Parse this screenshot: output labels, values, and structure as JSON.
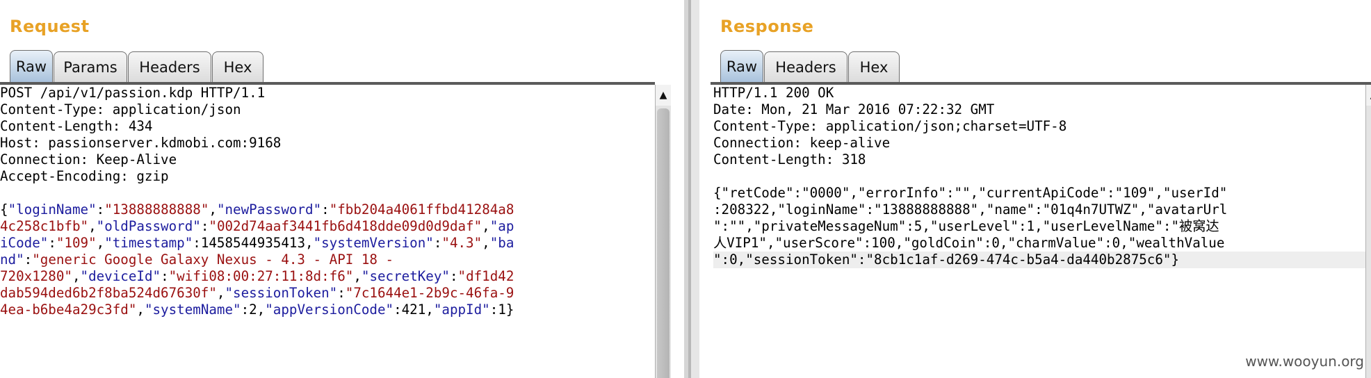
{
  "request": {
    "title": "Request",
    "tabs": [
      {
        "label": "Raw",
        "active": true
      },
      {
        "label": "Params",
        "active": false
      },
      {
        "label": "Headers",
        "active": false
      },
      {
        "label": "Hex",
        "active": false
      }
    ],
    "lines": [
      [
        {
          "t": "POST /api/v1/passion.kdp HTTP/1.1"
        }
      ],
      [
        {
          "t": "Content-Type: application/json"
        }
      ],
      [
        {
          "t": "Content-Length: 434"
        }
      ],
      [
        {
          "t": "Host: passionserver.kdmobi.com:9168"
        }
      ],
      [
        {
          "t": "Connection: Keep-Alive"
        }
      ],
      [
        {
          "t": "Accept-Encoding: gzip"
        }
      ],
      [
        {
          "t": ""
        }
      ],
      [
        {
          "t": "{"
        },
        {
          "t": "\"loginName\"",
          "c": "k"
        },
        {
          "t": ":"
        },
        {
          "t": "\"13888888888\"",
          "c": "s"
        },
        {
          "t": ","
        },
        {
          "t": "\"newPassword\"",
          "c": "k"
        },
        {
          "t": ":"
        },
        {
          "t": "\"fbb204a4061ffbd41284a8",
          "c": "s"
        }
      ],
      [
        {
          "t": "4c258c1bfb\"",
          "c": "s"
        },
        {
          "t": ","
        },
        {
          "t": "\"oldPassword\"",
          "c": "k"
        },
        {
          "t": ":"
        },
        {
          "t": "\"002d74aaf3441fb6d418dde09d0d9daf\"",
          "c": "s"
        },
        {
          "t": ","
        },
        {
          "t": "\"ap",
          "c": "k"
        }
      ],
      [
        {
          "t": "iCode\"",
          "c": "k"
        },
        {
          "t": ":"
        },
        {
          "t": "\"109\"",
          "c": "s"
        },
        {
          "t": ","
        },
        {
          "t": "\"timestamp\"",
          "c": "k"
        },
        {
          "t": ":1458544935413,"
        },
        {
          "t": "\"systemVersion\"",
          "c": "k"
        },
        {
          "t": ":"
        },
        {
          "t": "\"4.3\"",
          "c": "s"
        },
        {
          "t": ","
        },
        {
          "t": "\"ba",
          "c": "k"
        }
      ],
      [
        {
          "t": "nd\"",
          "c": "k"
        },
        {
          "t": ":"
        },
        {
          "t": "\"generic Google Galaxy Nexus - 4.3 - API 18 -",
          "c": "s"
        }
      ],
      [
        {
          "t": "720x1280\"",
          "c": "s"
        },
        {
          "t": ","
        },
        {
          "t": "\"deviceId\"",
          "c": "k"
        },
        {
          "t": ":"
        },
        {
          "t": "\"wifi08:00:27:11:8d:f6\"",
          "c": "s"
        },
        {
          "t": ","
        },
        {
          "t": "\"secretKey\"",
          "c": "k"
        },
        {
          "t": ":"
        },
        {
          "t": "\"df1d42",
          "c": "s"
        }
      ],
      [
        {
          "t": "dab594ded6b2f8ba524d67630f\"",
          "c": "s"
        },
        {
          "t": ","
        },
        {
          "t": "\"sessionToken\"",
          "c": "k"
        },
        {
          "t": ":"
        },
        {
          "t": "\"7c1644e1-2b9c-46fa-9",
          "c": "s"
        }
      ],
      [
        {
          "t": "4ea-b6be4a29c3fd\"",
          "c": "s"
        },
        {
          "t": ","
        },
        {
          "t": "\"systemName\"",
          "c": "k"
        },
        {
          "t": ":2,"
        },
        {
          "t": "\"appVersionCode\"",
          "c": "k"
        },
        {
          "t": ":421,"
        },
        {
          "t": "\"appId\"",
          "c": "k"
        },
        {
          "t": ":1}"
        }
      ]
    ]
  },
  "response": {
    "title": "Response",
    "tabs": [
      {
        "label": "Raw",
        "active": true
      },
      {
        "label": "Headers",
        "active": false
      },
      {
        "label": "Hex",
        "active": false
      }
    ],
    "lines": [
      [
        {
          "t": "HTTP/1.1 200 OK"
        }
      ],
      [
        {
          "t": "Date: Mon, 21 Mar 2016 07:22:32 GMT"
        }
      ],
      [
        {
          "t": "Content-Type: application/json;charset=UTF-8"
        }
      ],
      [
        {
          "t": "Connection: keep-alive"
        }
      ],
      [
        {
          "t": "Content-Length: 318"
        }
      ],
      [
        {
          "t": ""
        }
      ],
      [
        {
          "t": "{\"retCode\":\"0000\",\"errorInfo\":\"\",\"currentApiCode\":\"109\",\"userId\""
        }
      ],
      [
        {
          "t": ":208322,\"loginName\":\"13888888888\",\"name\":\"01q4n7UTWZ\",\"avatarUrl"
        }
      ],
      [
        {
          "t": "\":\"\",\"privateMessageNum\":5,\"userLevel\":1,\"userLevelName\":\"被窝达"
        }
      ],
      [
        {
          "t": "人VIP1\",\"userScore\":100,\"goldCoin\":0,\"charmValue\":0,\"wealthValue"
        }
      ],
      [
        {
          "t": "\":0,\"sessionToken\":\"8cb1c1af-d269-474c-b5a4-da440b2875c6\"}",
          "hl": true
        }
      ]
    ]
  },
  "watermark": "www.wooyun.org",
  "colors": {
    "title": "#e8a226",
    "json_key": "#1c1c9e",
    "json_string": "#9a1010",
    "active_tab": "#a9c2dc"
  }
}
